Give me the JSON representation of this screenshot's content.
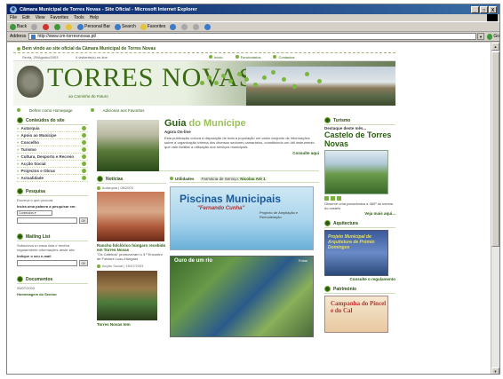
{
  "window": {
    "title": "Câmara Municipal de Torres Novas - Site Oficial - Microsoft Internet Explorer",
    "buttons": [
      "_",
      "□",
      "X"
    ]
  },
  "menubar": [
    "File",
    "Edit",
    "View",
    "Favorites",
    "Tools",
    "Help"
  ],
  "toolbar": {
    "back": "Back",
    "personal_bar": "Personal Bar",
    "search": "Search",
    "favorites": "Favorites"
  },
  "address": {
    "label": "Address",
    "url": "http://www.cm-torresnovas.pt/",
    "go": "Go"
  },
  "site": {
    "welcome": "Bem vindo ao site oficial da Câmara Municipal de Torres Novas",
    "date": "Sexta, 29/Agosto/2003",
    "visits": "4 visitante(s) on-line",
    "toplinks": [
      "Início",
      "Funcionários",
      "Contactos"
    ],
    "logo": "TORRES NOVAS",
    "logo_sub": "ao Caminho do Futuro",
    "subnav": [
      "Definir como Homepage",
      "Adicionar aos Favoritos"
    ]
  },
  "left": {
    "contents_title": "Conteúdos do site",
    "menu": [
      "Autarquia",
      "Apoio ao Munícipe",
      "Concelho",
      "Turismo",
      "Cultura, Desporto e Recreio",
      "Acção Social",
      "Projectos e Obras",
      "Actualidade"
    ],
    "search_title": "Pesquisa",
    "search_text": "Escreva o que procura.",
    "search_label": "Insira uma palavra a pesquisar em:",
    "search_select": "Conteúdos",
    "ok": "OK",
    "mailing_title": "Mailing List",
    "mailing_text": "Subscreva a nossa lista e receba regularmente informações deste site.",
    "mailing_label": "Indique o seu e-mail",
    "docs_title": "Documentos",
    "docs_date": "25/07/2003",
    "docs_item": "Homenagem do Senhor"
  },
  "middle": {
    "guia_title_dark": "Guia",
    "guia_title_light": "do Munícipe",
    "guia_sub": "Agora On-line",
    "guia_body": "Esta publicação coloca à disposição de toda a população um vasto conjunto de informações sobre a organização interna dos diversos sectores camarários, constituindo um útil instrumento que vale facilitar a utilização dos serviços municipais.",
    "guia_more": "Consulte aqui",
    "news_title": "Notícias",
    "news1_date": "Autarquia | 08/2003",
    "news1_head": "Rancho folclórico húngaro recebido em Torres Novas",
    "news1_body": "\"Os Cafeiros\" promoveram o 3.º Encontro de Folclore Luso-Húngaro",
    "news2_date": "Acção Social | 16/07/2003",
    "news2_head": "Torres Novas tem",
    "util_title": "Utilidades",
    "farmacia_label": "Farmácia de Serviço:",
    "farmacia_name": "Nicolau Até 1",
    "piscinas_title": "Piscinas Municipais",
    "piscinas_sub": "\"Fernando Cunha\"",
    "piscinas_note": "Projecto de Ampliação e Remodelação",
    "park_label": "Ouro de um rio",
    "park_label2": "Fotos"
  },
  "right": {
    "turismo_title": "Turismo",
    "turismo_sub": "Destaque deste mês...",
    "castelo": "Castelo de Torres Novas",
    "castelo_note": "Observe uma panorâmica a 360º do interior do castelo",
    "veja_mais": "Veja mais aqui...",
    "aqui_title": "Aquitectura",
    "aqui_text": "Projeto Municipal de Arquitetura de Prémio Domingos",
    "consulte": "Consulte o regulamento",
    "pat_title": "Património",
    "pat_text": "Campanha do Pincel e do Cal"
  }
}
